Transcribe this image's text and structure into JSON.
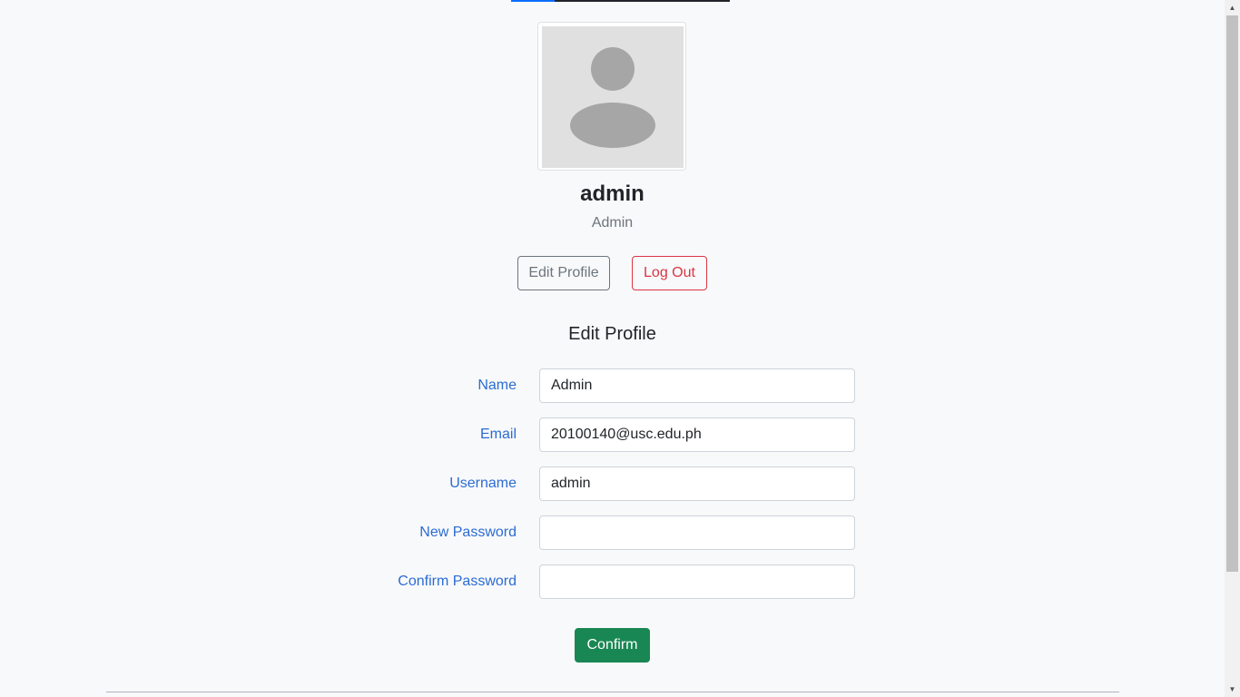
{
  "profile": {
    "display_name": "admin",
    "role": "Admin",
    "avatar_icon": "user-silhouette-icon"
  },
  "actions": {
    "edit_profile_label": "Edit Profile",
    "logout_label": "Log Out"
  },
  "form": {
    "title": "Edit Profile",
    "fields": [
      {
        "label": "Name",
        "value": "Admin",
        "type": "text"
      },
      {
        "label": "Email",
        "value": "20100140@usc.edu.ph",
        "type": "text"
      },
      {
        "label": "Username",
        "value": "admin",
        "type": "text"
      },
      {
        "label": "New Password",
        "value": "",
        "type": "password"
      },
      {
        "label": "Confirm Password",
        "value": "",
        "type": "password"
      }
    ],
    "confirm_label": "Confirm"
  },
  "colors": {
    "label": "#2b6cd4",
    "danger": "#dc3545",
    "success": "#198754",
    "secondary": "#6c757d"
  }
}
